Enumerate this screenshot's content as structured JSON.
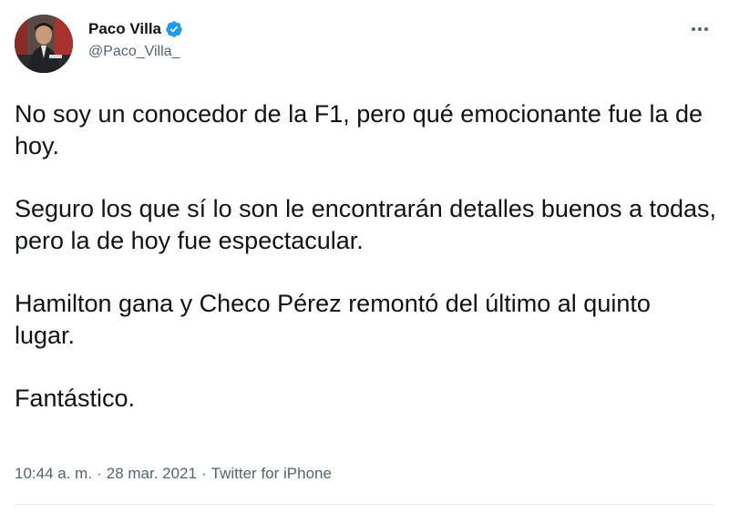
{
  "author": {
    "display_name": "Paco Villa",
    "handle": "@Paco_Villa_",
    "verified": true
  },
  "tweet": {
    "paragraphs": [
      "No soy un conocedor de la F1, pero qué emocionante fue la de hoy.",
      "Seguro los que sí lo son le encontrarán detalles buenos a todas, pero la de hoy fue espectacular.",
      "Hamilton gana y Checo Pérez remontó del último al quinto lugar.",
      "Fantástico."
    ]
  },
  "meta": {
    "time": "10:44 a. m.",
    "separator": "·",
    "date": "28 mar. 2021",
    "source": "Twitter for iPhone"
  },
  "icons": {
    "verified": "verified-badge-icon",
    "more": "more-options-icon"
  },
  "colors": {
    "verified_blue": "#1d9bf0",
    "secondary_text": "#536471",
    "primary_text": "#0f1419"
  }
}
